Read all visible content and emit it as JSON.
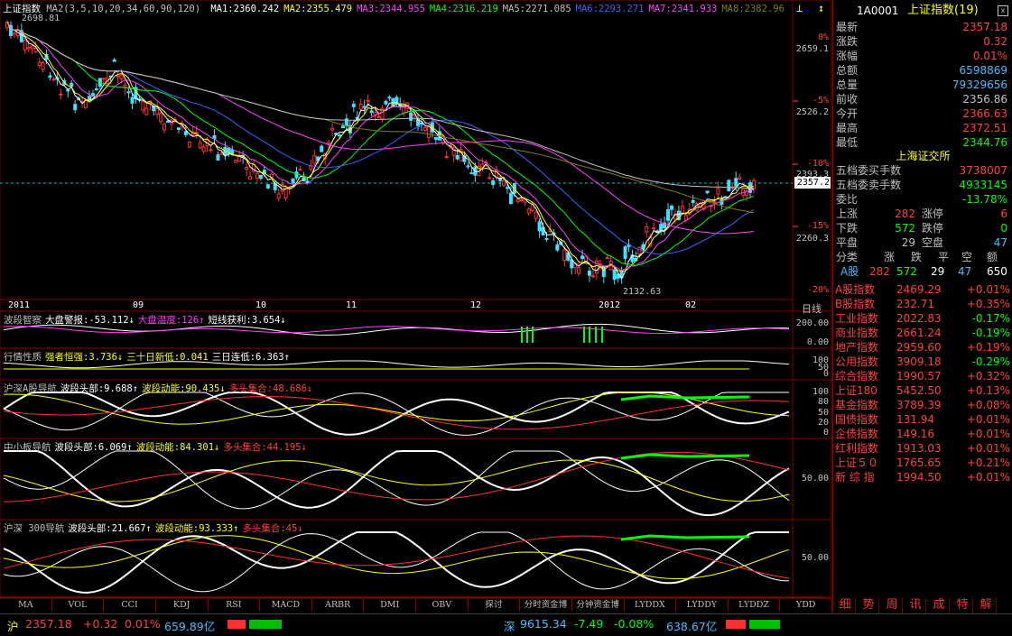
{
  "chart_main": {
    "title": "上证指数",
    "ma_params": "MA2(3,5,10,20,34,60,90,120)",
    "ma_values": [
      {
        "label": "MA1:2360.242",
        "color": "#ffffff"
      },
      {
        "label": "MA2:2355.479",
        "color": "#ffff00"
      },
      {
        "label": "MA3:2344.955",
        "color": "#ff40ff"
      },
      {
        "label": "MA4:2316.219",
        "color": "#00ff00"
      },
      {
        "label": "MA5:2271.085",
        "color": "#c0c0c0"
      },
      {
        "label": "MA6:2293.271",
        "color": "#4060ff"
      },
      {
        "label": "MA7:2341.933",
        "color": "#ff40ff"
      },
      {
        "label": "MA8:2382.96",
        "color": "#808000"
      }
    ],
    "high_label": "2698.81",
    "low_label": "2132.63",
    "current_tag": "2357.2",
    "price_axis": [
      "2659.1",
      "2526.2",
      "2393.3",
      "2260.3"
    ],
    "pct_axis": [
      "0%",
      "-5%",
      "-10%",
      "-15%",
      "-20%"
    ],
    "date_axis": [
      "2011",
      "09",
      "10",
      "11",
      "12",
      "2012",
      "02"
    ],
    "period_label": "日线"
  },
  "panes": [
    {
      "items": [
        {
          "t": "波段智察",
          "c": "#c0c0c0"
        },
        {
          "t": "大盘警报:-53.112↓",
          "c": "#ffffff"
        },
        {
          "t": "大盘温度:126↑",
          "c": "#ff40ff"
        },
        {
          "t": "短线获利:3.654↓",
          "c": "#ffffff"
        }
      ],
      "axis": [
        "200.00",
        "0.00"
      ]
    },
    {
      "items": [
        {
          "t": "行情性质",
          "c": "#c0c0c0"
        },
        {
          "t": "强者恒强:3.736↓",
          "c": "#ffff00"
        },
        {
          "t": "三十日新低:0.041",
          "c": "#ffff00"
        },
        {
          "t": "三日连低:6.363↑",
          "c": "#ffffff"
        }
      ],
      "axis": [
        "100",
        "50",
        "0"
      ]
    },
    {
      "items": [
        {
          "t": "沪深A股导航",
          "c": "#c0c0c0"
        },
        {
          "t": "波段头部:9.688↑",
          "c": "#ffffff"
        },
        {
          "t": "波段动能:90.435↓",
          "c": "#ffff00"
        },
        {
          "t": "多头集合:48.686↓",
          "c": "#ff4040"
        }
      ],
      "axis": [
        "100",
        "80",
        "50",
        "20",
        "0"
      ]
    },
    {
      "items": [
        {
          "t": "中小板导航",
          "c": "#c0c0c0"
        },
        {
          "t": "波段头部:6.069↑",
          "c": "#ffffff"
        },
        {
          "t": "波段动能:84.301↓",
          "c": "#ffff00"
        },
        {
          "t": "多头集合:44.195↓",
          "c": "#ff4040"
        }
      ],
      "axis": [
        "50.00"
      ]
    },
    {
      "items": [
        {
          "t": "沪深 300导航",
          "c": "#c0c0c0"
        },
        {
          "t": "波段头部:21.667↑",
          "c": "#ffffff"
        },
        {
          "t": "波段动能:93.333↑",
          "c": "#ffff00"
        },
        {
          "t": "多头集合:45↓",
          "c": "#ff4040"
        }
      ],
      "axis": [
        "50.00"
      ]
    }
  ],
  "bottom_tabs": [
    "MA",
    "VOL",
    "CCI",
    "KDJ",
    "RSI",
    "MACD",
    "ARBR",
    "DMI",
    "OBV",
    "探讨",
    "分时资金博",
    "分钟资金博",
    "LYDDX",
    "LYDDY",
    "LYDDZ",
    "YDD"
  ],
  "quote": {
    "code": "1A0001",
    "name": "上证指数(19)",
    "rows": [
      {
        "label": "最新",
        "value": "2357.18",
        "color": "#ff4040"
      },
      {
        "label": "涨跌",
        "value": "0.32",
        "color": "#ff4040"
      },
      {
        "label": "涨幅",
        "value": "0.01%",
        "color": "#ff4040"
      },
      {
        "label": "总额",
        "value": "6598869",
        "color": "#40c0ff"
      },
      {
        "label": "总量",
        "value": "79329656",
        "color": "#40c0ff"
      },
      {
        "label": "前收",
        "value": "2356.86",
        "color": "#c0c0c0"
      },
      {
        "label": "今开",
        "value": "2366.63",
        "color": "#ff4040"
      },
      {
        "label": "最高",
        "value": "2372.51",
        "color": "#ff4040"
      },
      {
        "label": "最低",
        "value": "2344.76",
        "color": "#00ff00"
      }
    ],
    "exchange": "上海证交所",
    "book": [
      {
        "label": "五档委买手数",
        "value": "3738007",
        "color": "#ff4040"
      },
      {
        "label": "五档委卖手数",
        "value": "4933145",
        "color": "#00ff00"
      },
      {
        "label": "委比",
        "value": "-13.78%",
        "color": "#00ff00"
      }
    ],
    "breadth": [
      {
        "l1": "上涨",
        "v1": "282",
        "l2": "涨停",
        "v2": "6",
        "c1": "#ff4040",
        "c2": "#ff4040"
      },
      {
        "l1": "下跌",
        "v1": "572",
        "l2": "跌停",
        "v2": "0",
        "c1": "#00ff00",
        "c2": "#00ff00"
      },
      {
        "l1": "平盘",
        "v1": "29",
        "l2": "空盘",
        "v2": "47",
        "c1": "#c0c0c0",
        "c2": "#40c0ff"
      }
    ],
    "class_header": [
      "分类",
      "涨",
      "跌",
      "平",
      "空",
      "额"
    ],
    "class_row": [
      "A股",
      "282",
      "572",
      "29",
      "47",
      "650"
    ]
  },
  "indices": [
    {
      "n": "A股指数",
      "v": "2469.29",
      "p": "+0.01%",
      "c": "#ff4040"
    },
    {
      "n": "B股指数",
      "v": "232.71",
      "p": "+0.35%",
      "c": "#ff4040"
    },
    {
      "n": "工业指数",
      "v": "2022.83",
      "p": "-0.17%",
      "c": "#00ff00"
    },
    {
      "n": "商业指数",
      "v": "2661.24",
      "p": "-0.19%",
      "c": "#00ff00"
    },
    {
      "n": "地产指数",
      "v": "2959.60",
      "p": "+0.19%",
      "c": "#ff4040"
    },
    {
      "n": "公用指数",
      "v": "3909.18",
      "p": "-0.29%",
      "c": "#00ff00"
    },
    {
      "n": "综合指数",
      "v": "1990.57",
      "p": "+0.32%",
      "c": "#ff4040"
    },
    {
      "n": "上证180",
      "v": "5452.50",
      "p": "+0.13%",
      "c": "#ff4040"
    },
    {
      "n": "基金指数",
      "v": "3789.39",
      "p": "+0.08%",
      "c": "#ff4040"
    },
    {
      "n": "国债指数",
      "v": "131.94",
      "p": "+0.01%",
      "c": "#ff4040"
    },
    {
      "n": "企债指数",
      "v": "149.16",
      "p": "+0.01%",
      "c": "#ff4040"
    },
    {
      "n": "红利指数",
      "v": "1913.03",
      "p": "+0.01%",
      "c": "#ff4040"
    },
    {
      "n": "上证５０",
      "v": "1765.65",
      "p": "+0.21%",
      "c": "#ff4040"
    },
    {
      "n": "新 综 指",
      "v": "1994.50",
      "p": "+0.01%",
      "c": "#ff4040"
    }
  ],
  "right_tabs": [
    "细",
    "势",
    "周",
    "讯",
    "成",
    "特",
    "解"
  ],
  "status": {
    "sh_label": "沪",
    "sh_price": "2357.18",
    "sh_chg": "+0.32",
    "sh_pct": "0.01%",
    "sh_amt": "659.89亿",
    "sz_label": "深",
    "sz_price": "9615.34",
    "sz_chg": "-7.49",
    "sz_pct": "-0.08%",
    "sz_amt": "638.67亿"
  }
}
